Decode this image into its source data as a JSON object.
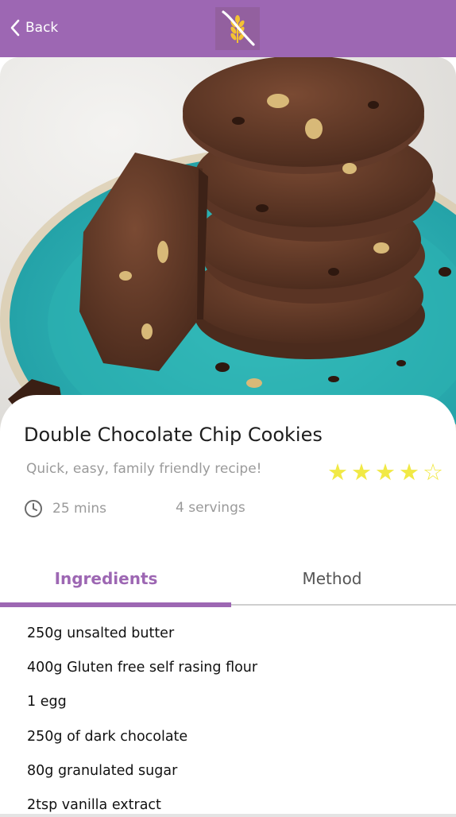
{
  "nav": {
    "back_label": "Back",
    "logo_icon": "gluten-free-wheat-icon"
  },
  "hero": {
    "icon": "double-chocolate-cookie-stack-photo"
  },
  "recipe": {
    "title": "Double Chocolate Chip Cookies",
    "subtitle": "Quick, easy, family friendly recipe!",
    "rating": 4,
    "rating_max": 5,
    "star_filled": "★",
    "star_empty": "☆",
    "time": "25 mins",
    "servings": "4 servings"
  },
  "tabs": {
    "ingredients_label": "Ingredients",
    "method_label": "Method",
    "active": "ingredients"
  },
  "ingredients": [
    "250g unsalted butter",
    "400g Gluten free self rasing flour",
    "1 egg",
    "250g of dark chocolate",
    "80g granulated sugar",
    "2tsp vanilla extract"
  ],
  "colors": {
    "brand_purple": "#9d67b3",
    "star_yellow": "#f1e945",
    "plate_teal": "#2fb3b5"
  }
}
